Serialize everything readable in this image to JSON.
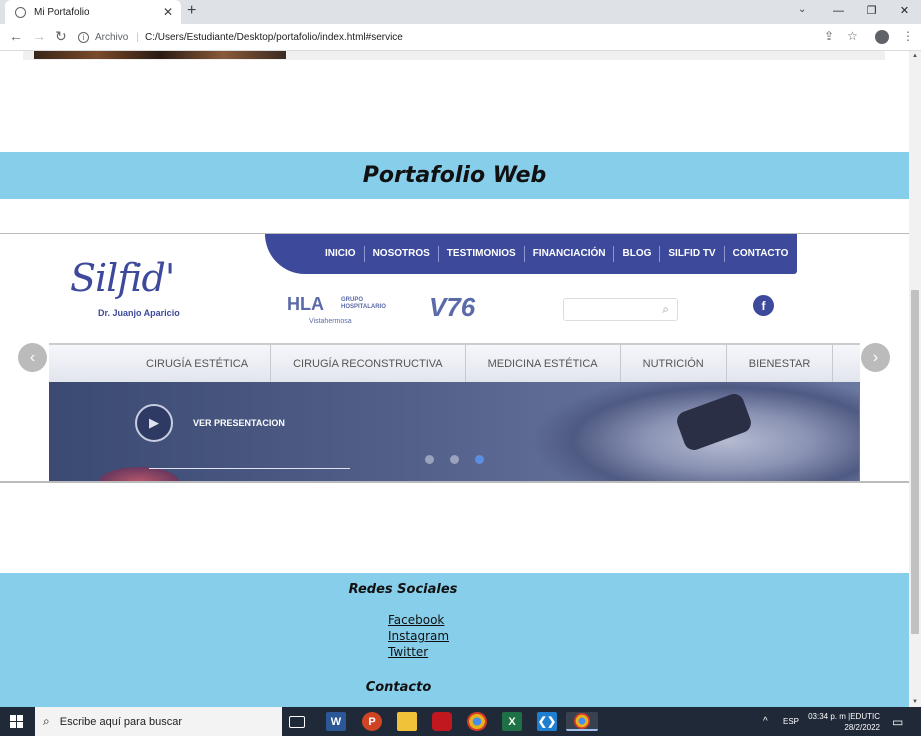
{
  "browser": {
    "tab_title": "Mi Portafolio",
    "new_tab": "+",
    "tab_close": "✕",
    "address_scheme": "Archivo",
    "address_url": "C:/Users/Estudiante/Desktop/portafolio/index.html#service",
    "window_min": "—",
    "window_restore": "❐",
    "window_close": "✕",
    "tab_dropdown": "⌄"
  },
  "page": {
    "section_title": "Portafolio Web",
    "preview": {
      "nav": [
        "INICIO",
        "NOSOTROS",
        "TESTIMONIOS",
        "FINANCIACIÓN",
        "BLOG",
        "SILFID TV",
        "CONTACTO"
      ],
      "logo_script": "Silfid'",
      "logo_sub": "Dr. Juanjo Aparicio",
      "hla": "HLA",
      "hla_group": "GRUPO HOSPITALARIO",
      "hla_place": "Vistahermosa",
      "v76": "V76",
      "fb": "f",
      "menu": [
        "CIRUGÍA ESTÉTICA",
        "CIRUGÍA RECONSTRUCTIVA",
        "MEDICINA ESTÉTICA",
        "NUTRICIÓN",
        "BIENESTAR"
      ],
      "banner_cta": "VER PRESENTACION",
      "slides": 3,
      "active_slide": 3
    },
    "footer": {
      "social_title": "Redes Sociales",
      "links": [
        "Facebook",
        "Instagram",
        "Twitter"
      ],
      "contact_title": "Contacto"
    }
  },
  "taskbar": {
    "search_placeholder": "Escribe aquí para buscar",
    "lang": "ESP",
    "time": "03:34 p. m |EDUTIC",
    "date": "28/2/2022"
  },
  "colors": {
    "accent_band": "#87ceeb",
    "site_blue": "#3d4a9c",
    "taskbar": "#1f2938"
  }
}
